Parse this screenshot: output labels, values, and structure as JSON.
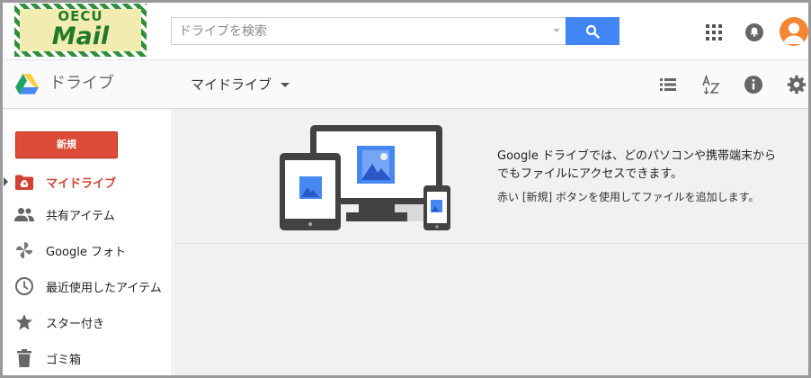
{
  "logo": {
    "line1": "OECU",
    "line2": "Mail"
  },
  "search": {
    "placeholder": "ドライブを検索",
    "value": ""
  },
  "header": {
    "app_name": "ドライブ",
    "location": "マイドライブ"
  },
  "sidebar": {
    "new_label": "新規",
    "items": [
      {
        "label": "マイドライブ",
        "icon": "drive-folder-icon",
        "active": true
      },
      {
        "label": "共有アイテム",
        "icon": "people-icon",
        "active": false
      },
      {
        "label": "Google フォト",
        "icon": "pinwheel-icon",
        "active": false
      },
      {
        "label": "最近使用したアイテム",
        "icon": "clock-icon",
        "active": false
      },
      {
        "label": "スター付き",
        "icon": "star-icon",
        "active": false
      },
      {
        "label": "ゴミ箱",
        "icon": "trash-icon",
        "active": false
      }
    ]
  },
  "empty_state": {
    "headline": "Google ドライブでは、どのパソコンや携帯端末からでもファイルにアクセスできます。",
    "hint": "赤い [新規] ボタンを使用してファイルを追加します。"
  },
  "colors": {
    "accent_blue": "#4285f4",
    "new_button_red": "#dd4b39",
    "active_text_red": "#d23f31",
    "avatar_orange": "#f58634",
    "logo_green": "#1f7a2c"
  }
}
